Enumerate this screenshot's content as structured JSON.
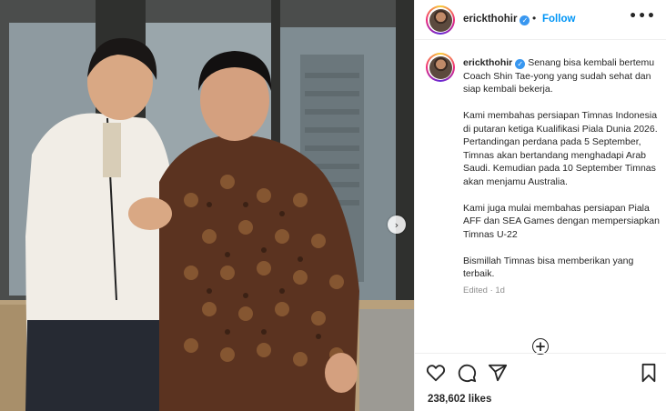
{
  "post": {
    "username": "erickthohir",
    "verified_icon": "verified-badge-icon",
    "follow_label": "Follow",
    "separator": "•",
    "more_icon": "•••",
    "caption_paragraphs": [
      "Senang bisa kembali bertemu Coach Shin Tae-yong yang sudah sehat dan siap kembali bekerja.",
      "Kami membahas persiapan Timnas Indonesia di putaran ketiga Kualifikasi Piala Dunia 2026. Pertandingan perdana pada 5 September, Timnas akan bertandang menghadapi Arab Saudi. Kemudian pada 10 September Timnas akan menjamu Australia.",
      "Kami juga mulai membahas persiapan Piala AFF dan SEA Games dengan mempersiapkan Timnas U-22",
      "Bismillah Timnas bisa memberikan yang terbaik."
    ],
    "edited_label": "Edited · 1d",
    "likes_label": "238,602 likes",
    "carousel_next_glyph": "›",
    "add_comment_glyph": "+"
  },
  "colors": {
    "accent": "#0095f6",
    "verified": "#3897f0",
    "muted": "#8e8e8e",
    "text": "#262626"
  },
  "icons": [
    "heart-icon",
    "comment-icon",
    "share-icon",
    "bookmark-icon",
    "add-comment-icon",
    "chevron-right-icon"
  ]
}
